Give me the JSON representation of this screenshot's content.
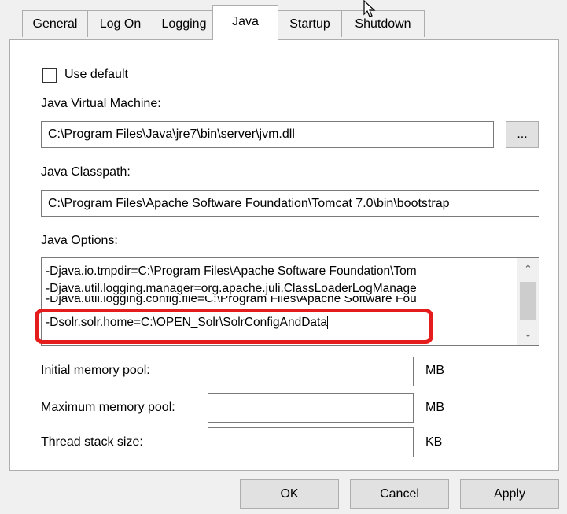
{
  "tabs": [
    {
      "label": "General"
    },
    {
      "label": "Log On"
    },
    {
      "label": "Logging"
    },
    {
      "label": "Java"
    },
    {
      "label": "Startup"
    },
    {
      "label": "Shutdown"
    }
  ],
  "use_default": {
    "label": "Use default",
    "checked": false
  },
  "jvm": {
    "label": "Java Virtual Machine:",
    "value": "C:\\Program Files\\Java\\jre7\\bin\\server\\jvm.dll",
    "browse_label": "..."
  },
  "classpath": {
    "label": "Java Classpath:",
    "value": "C:\\Program Files\\Apache Software Foundation\\Tomcat 7.0\\bin\\bootstrap"
  },
  "options": {
    "label": "Java Options:",
    "lines": [
      "-Djava.io.tmpdir=C:\\Program Files\\Apache Software Foundation\\Tom",
      "-Djava.util.logging.manager=org.apache.juli.ClassLoaderLogManage",
      "-Djava.util.logging.config.file=C:\\Program Files\\Apache Software Fou",
      "-Dsolr.solr.home=C:\\OPEN_Solr\\SolrConfigAndData"
    ]
  },
  "memory": {
    "initial_label": "Initial memory pool:",
    "initial_value": "",
    "initial_unit": "MB",
    "maximum_label": "Maximum memory pool:",
    "maximum_value": "",
    "maximum_unit": "MB",
    "stack_label": "Thread stack size:",
    "stack_value": "",
    "stack_unit": "KB"
  },
  "buttons": {
    "ok": "OK",
    "cancel": "Cancel",
    "apply": "Apply"
  },
  "colors": {
    "highlight": "#e41c1c"
  }
}
